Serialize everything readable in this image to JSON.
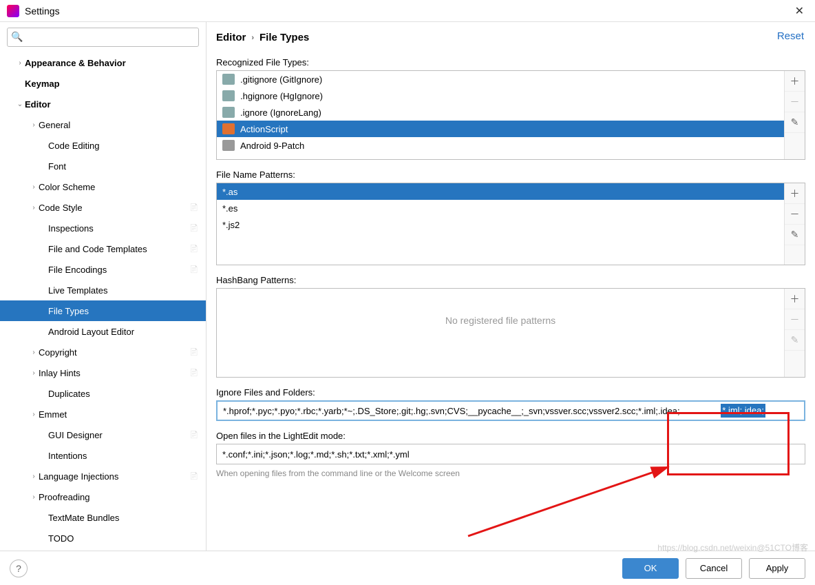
{
  "window": {
    "title": "Settings"
  },
  "search": {
    "placeholder": ""
  },
  "tree": [
    {
      "label": "Appearance & Behavior",
      "depth": 0,
      "arrow": "›",
      "bold": true
    },
    {
      "label": "Keymap",
      "depth": 0,
      "arrow": "",
      "bold": true
    },
    {
      "label": "Editor",
      "depth": 0,
      "arrow": "⌄",
      "bold": true
    },
    {
      "label": "General",
      "depth": 1,
      "arrow": "›"
    },
    {
      "label": "Code Editing",
      "depth": 2,
      "arrow": ""
    },
    {
      "label": "Font",
      "depth": 2,
      "arrow": ""
    },
    {
      "label": "Color Scheme",
      "depth": 1,
      "arrow": "›"
    },
    {
      "label": "Code Style",
      "depth": 1,
      "arrow": "›",
      "scope": true
    },
    {
      "label": "Inspections",
      "depth": 2,
      "arrow": "",
      "scope": true
    },
    {
      "label": "File and Code Templates",
      "depth": 2,
      "arrow": "",
      "scope": true
    },
    {
      "label": "File Encodings",
      "depth": 2,
      "arrow": "",
      "scope": true
    },
    {
      "label": "Live Templates",
      "depth": 2,
      "arrow": ""
    },
    {
      "label": "File Types",
      "depth": 2,
      "arrow": "",
      "selected": true
    },
    {
      "label": "Android Layout Editor",
      "depth": 2,
      "arrow": ""
    },
    {
      "label": "Copyright",
      "depth": 1,
      "arrow": "›",
      "scope": true
    },
    {
      "label": "Inlay Hints",
      "depth": 1,
      "arrow": "›",
      "scope": true
    },
    {
      "label": "Duplicates",
      "depth": 2,
      "arrow": ""
    },
    {
      "label": "Emmet",
      "depth": 1,
      "arrow": "›"
    },
    {
      "label": "GUI Designer",
      "depth": 2,
      "arrow": "",
      "scope": true
    },
    {
      "label": "Intentions",
      "depth": 2,
      "arrow": ""
    },
    {
      "label": "Language Injections",
      "depth": 1,
      "arrow": "›",
      "scope": true
    },
    {
      "label": "Proofreading",
      "depth": 1,
      "arrow": "›"
    },
    {
      "label": "TextMate Bundles",
      "depth": 2,
      "arrow": ""
    },
    {
      "label": "TODO",
      "depth": 2,
      "arrow": ""
    }
  ],
  "breadcrumb": {
    "root": "Editor",
    "leaf": "File Types",
    "reset": "Reset"
  },
  "sections": {
    "recognized": "Recognized File Types:",
    "patterns": "File Name Patterns:",
    "hashbang": "HashBang Patterns:",
    "hashbang_empty": "No registered file patterns",
    "ignore": "Ignore Files and Folders:",
    "lightedit": "Open files in the LightEdit mode:",
    "lightedit_hint": "When opening files from the command line or the Welcome screen"
  },
  "filetypes": [
    {
      "label": ".gitignore (GitIgnore)",
      "iconc": "#8aa"
    },
    {
      "label": ".hgignore (HgIgnore)",
      "iconc": "#8aa"
    },
    {
      "label": ".ignore (IgnoreLang)",
      "iconc": "#8aa"
    },
    {
      "label": "ActionScript",
      "iconc": "#e07030",
      "selected": true
    },
    {
      "label": "Android 9-Patch",
      "iconc": "#999"
    }
  ],
  "patterns": [
    {
      "label": "*.as",
      "selected": true
    },
    {
      "label": "*.es"
    },
    {
      "label": "*.js2"
    }
  ],
  "ignore_value": "*.hprof;*.pyc;*.pyo;*.rbc;*.yarb;*~;.DS_Store;.git;.hg;.svn;CVS;__pycache__;_svn;vssver.scc;vssver2.scc;*.iml;.idea;",
  "ignore_selected": "*.iml;.idea;",
  "lightedit_value": "*.conf;*.ini;*.json;*.log;*.md;*.sh;*.txt;*.xml;*.yml",
  "buttons": {
    "ok": "OK",
    "cancel": "Cancel",
    "apply": "Apply"
  },
  "watermark": "https://blog.csdn.net/weixin@51CTO博客"
}
